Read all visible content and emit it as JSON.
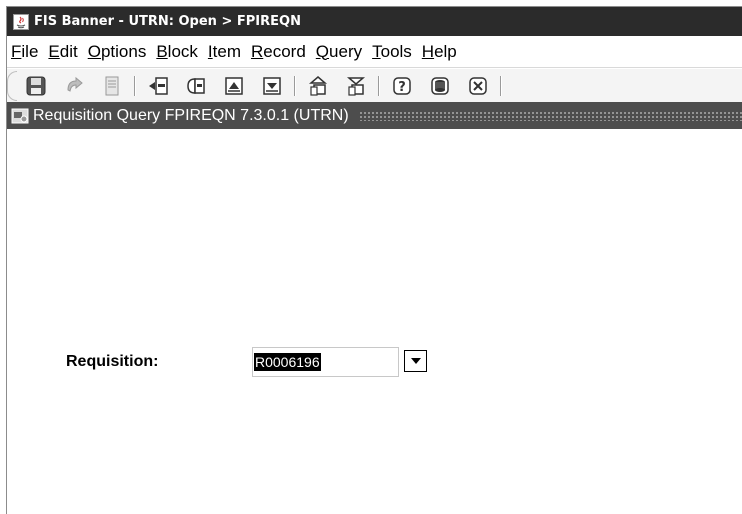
{
  "window": {
    "title": "FIS Banner - UTRN:  Open > FPIREQN"
  },
  "menu": [
    {
      "mnemonic": "F",
      "rest": "ile"
    },
    {
      "mnemonic": "E",
      "rest": "dit"
    },
    {
      "mnemonic": "O",
      "rest": "ptions"
    },
    {
      "mnemonic": "B",
      "rest": "lock"
    },
    {
      "mnemonic": "I",
      "rest": "tem"
    },
    {
      "mnemonic": "R",
      "rest": "ecord"
    },
    {
      "mnemonic": "Q",
      "rest": "uery"
    },
    {
      "mnemonic": "T",
      "rest": "ools"
    },
    {
      "mnemonic": "H",
      "rest": "elp"
    }
  ],
  "toolbar": {
    "icons": [
      "save-icon",
      "rollback-icon",
      "print-icon",
      "insert-record-icon",
      "remove-record-icon",
      "enter-query-icon",
      "execute-query-icon",
      "next-block-icon",
      "previous-block-icon",
      "help-icon",
      "database-icon",
      "exit-icon"
    ]
  },
  "form": {
    "title": "Requisition Query  FPIREQN  7.3.0.1  (UTRN)"
  },
  "fields": {
    "requisition_label": "Requisition:",
    "requisition_value": "R0006196"
  },
  "colors": {
    "titlebar": "#2b2b2b",
    "formbar": "#4d4d4d",
    "selection": "#000000"
  }
}
